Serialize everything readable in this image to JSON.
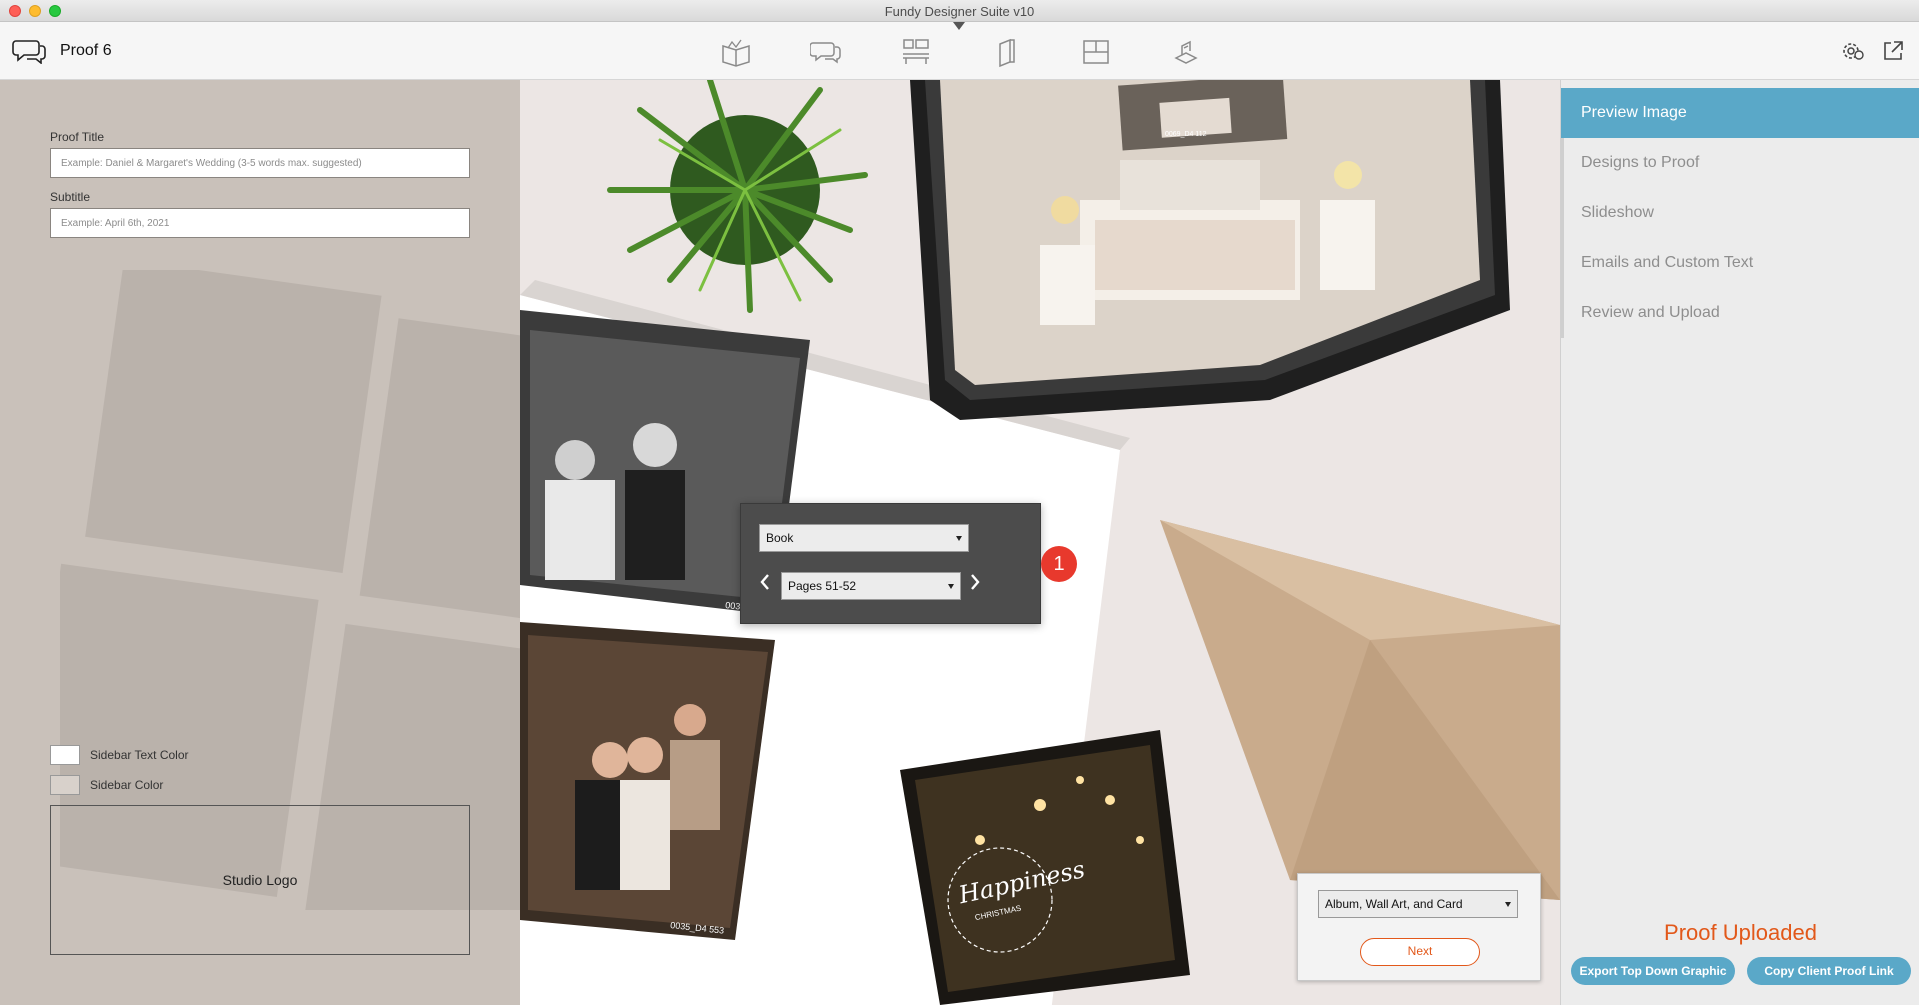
{
  "window": {
    "title": "Fundy Designer Suite v10"
  },
  "toolbar": {
    "proof_name": "Proof 6",
    "tools": [
      "album-tool-icon",
      "proof-tool-icon",
      "wall-art-tool-icon",
      "card-tool-icon",
      "layout-tool-icon",
      "ordering-tool-icon"
    ]
  },
  "left_panel": {
    "proof_title_label": "Proof Title",
    "proof_title_placeholder": "Example: Daniel & Margaret's Wedding (3-5 words max. suggested)",
    "subtitle_label": "Subtitle",
    "subtitle_placeholder": "Example: April 6th, 2021",
    "sidebar_text_color_label": "Sidebar Text Color",
    "sidebar_color_label": "Sidebar Color",
    "sidebar_text_color": "#ffffff",
    "sidebar_color": "#d8d1cb",
    "studio_logo_label": "Studio Logo"
  },
  "preview": {
    "book_select": "Book",
    "pages_select": "Pages 51-52",
    "badge": "1",
    "product_select": "Album, Wall Art, and Card",
    "next_label": "Next",
    "photo_labels": [
      "0069_D4 112",
      "0033_D4 487",
      "0035_D4 553"
    ],
    "card_text": "Happiness",
    "card_subtext": "CHRISTMAS"
  },
  "right_panel": {
    "menu": [
      {
        "label": "Preview Image",
        "active": true
      },
      {
        "label": "Designs to Proof",
        "active": false
      },
      {
        "label": "Slideshow",
        "active": false
      },
      {
        "label": "Emails and Custom Text",
        "active": false
      },
      {
        "label": "Review and Upload",
        "active": false
      }
    ],
    "status": "Proof Uploaded",
    "export_label": "Export Top Down Graphic",
    "copy_label": "Copy Client Proof Link"
  },
  "colors": {
    "accent_blue": "#5aa8c8",
    "accent_orange": "#e2581a",
    "badge_red": "#e8392d",
    "left_panel_bg": "#c9c1ba"
  }
}
